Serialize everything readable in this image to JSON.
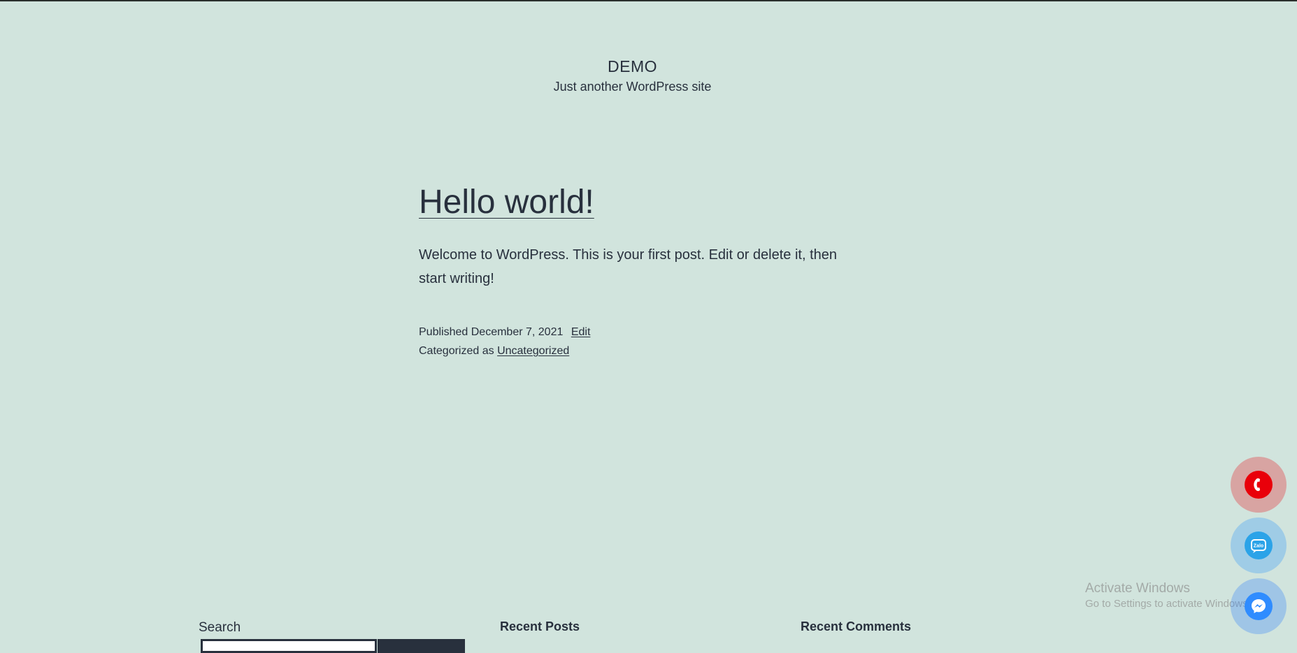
{
  "site": {
    "title": "DEMO",
    "tagline": "Just another WordPress site"
  },
  "post": {
    "title": "Hello world!",
    "body": "Welcome to WordPress. This is your first post. Edit or delete it, then start writing!",
    "published_label": "Published",
    "published_date": "December 7, 2021",
    "edit_label": "Edit",
    "categorized_label": "Categorized as",
    "category": "Uncategorized"
  },
  "footer": {
    "search_label": "Search",
    "recent_posts_heading": "Recent Posts",
    "recent_comments_heading": "Recent Comments"
  },
  "floating_buttons": [
    {
      "icon": "phone-icon",
      "color": "#e9000a"
    },
    {
      "icon": "zalo-icon",
      "color": "#2ba3e8",
      "label": "Zalo"
    },
    {
      "icon": "messenger-icon",
      "color": "#2f8cff"
    }
  ],
  "watermark": {
    "title": "Activate Windows",
    "subtitle": "Go to Settings to activate Windows."
  },
  "colors": {
    "background": "#d1e4dd",
    "text": "#28303d"
  }
}
